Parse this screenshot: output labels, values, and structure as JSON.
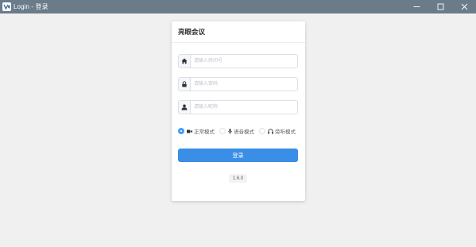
{
  "window": {
    "title": "Login - 登录",
    "app_icon": "video-logo-icon",
    "controls": [
      "minimize-icon",
      "maximize-icon",
      "close-icon"
    ]
  },
  "login_form": {
    "title": "亮眼会议",
    "meeting_id": {
      "value": "",
      "placeholder": "请输入房间号",
      "icon": "home-icon"
    },
    "password": {
      "value": "",
      "placeholder": "请输入密码",
      "icon": "lock-icon"
    },
    "nickname": {
      "value": "",
      "placeholder": "请输入昵称",
      "icon": "user-icon"
    },
    "modes": [
      {
        "label": "正常模式",
        "icon": "video-camera-icon",
        "selected": true
      },
      {
        "label": "语音模式",
        "icon": "microphone-icon",
        "selected": false
      },
      {
        "label": "旁听模式",
        "icon": "headphones-icon",
        "selected": false
      }
    ],
    "login_button": "登录",
    "version": "1.6.0"
  },
  "colors": {
    "titlebar": "#6a7b8a",
    "primary": "#3a8ee6",
    "radio_checked": "#409eff",
    "background": "#f0f0f0"
  }
}
